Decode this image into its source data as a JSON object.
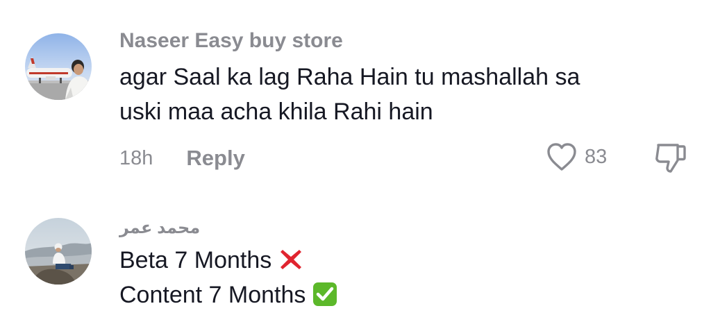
{
  "comments": [
    {
      "username": "Naseer Easy buy store",
      "lines": [
        "agar Saal ka lag Raha Hain tu mashallah sa",
        "uski maa acha khila Rahi hain"
      ],
      "time": "18h",
      "reply_label": "Reply",
      "like_count": "83",
      "avatar_icon": "profile-photo-airplane"
    },
    {
      "username": "محمد عمر",
      "lines": [
        "Beta 7 Months",
        "Content 7 Months"
      ],
      "line_emojis": [
        "cross-mark-icon",
        "check-mark-button-icon"
      ],
      "avatar_icon": "profile-photo-person-sitting"
    }
  ],
  "colors": {
    "primary_text": "#161823",
    "secondary_text": "#8a8b91",
    "cross_red": "#e0242f",
    "check_green": "#5cb82a"
  }
}
